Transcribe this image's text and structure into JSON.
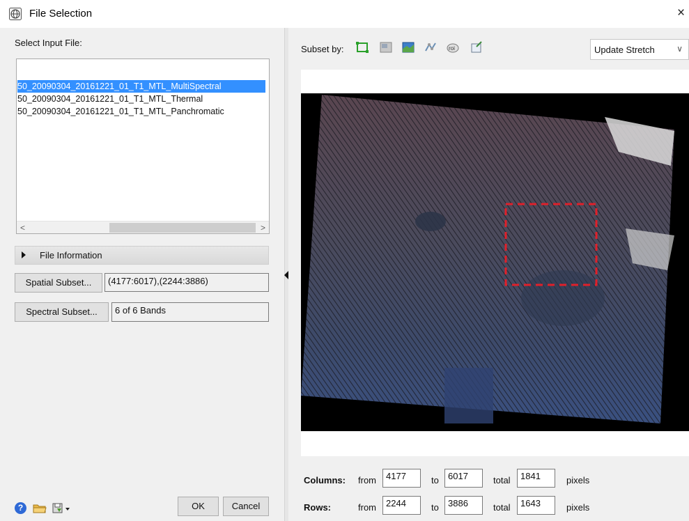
{
  "window": {
    "title": "File Selection",
    "close_glyph": "×",
    "icon": "globe-icon"
  },
  "left": {
    "select_label": "Select Input File:",
    "files": [
      {
        "label": "50_20090304_20161221_01_T1_MTL_MultiSpectral",
        "selected": true
      },
      {
        "label": "50_20090304_20161221_01_T1_MTL_Thermal",
        "selected": false
      },
      {
        "label": "50_20090304_20161221_01_T1_MTL_Panchromatic",
        "selected": false
      }
    ],
    "scroll_left_glyph": "<",
    "scroll_right_glyph": ">",
    "file_information_label": "File Information",
    "spatial_subset_button": "Spatial Subset...",
    "spatial_subset_value": "(4177:6017),(2244:3886)",
    "spectral_subset_button": "Spectral Subset...",
    "spectral_subset_value": "6 of 6 Bands",
    "help_glyph": "?",
    "ok_button": "OK",
    "cancel_button": "Cancel",
    "bottom_icons": [
      "help-icon",
      "open-folder-icon",
      "save-options-icon"
    ]
  },
  "right": {
    "subset_by_label": "Subset by:",
    "subset_icons": [
      "rectangle-subset-icon",
      "image-subset-icon",
      "map-subset-icon",
      "vector-subset-icon",
      "roi-subset-icon",
      "file-subset-icon"
    ],
    "stretch_select_value": "Update Stretch",
    "stretch_chevron": "∨",
    "columns_label": "Columns:",
    "rows_label": "Rows:",
    "from_label": "from",
    "to_label": "to",
    "total_label": "total",
    "pixels_label": "pixels",
    "columns": {
      "from": "4177",
      "to": "6017",
      "total": "1841"
    },
    "rows": {
      "from": "2244",
      "to": "3886",
      "total": "1643"
    }
  },
  "colors": {
    "selection": "#3390ff",
    "subset_box": "#e0202a",
    "window_bg": "#f0f0f0"
  }
}
